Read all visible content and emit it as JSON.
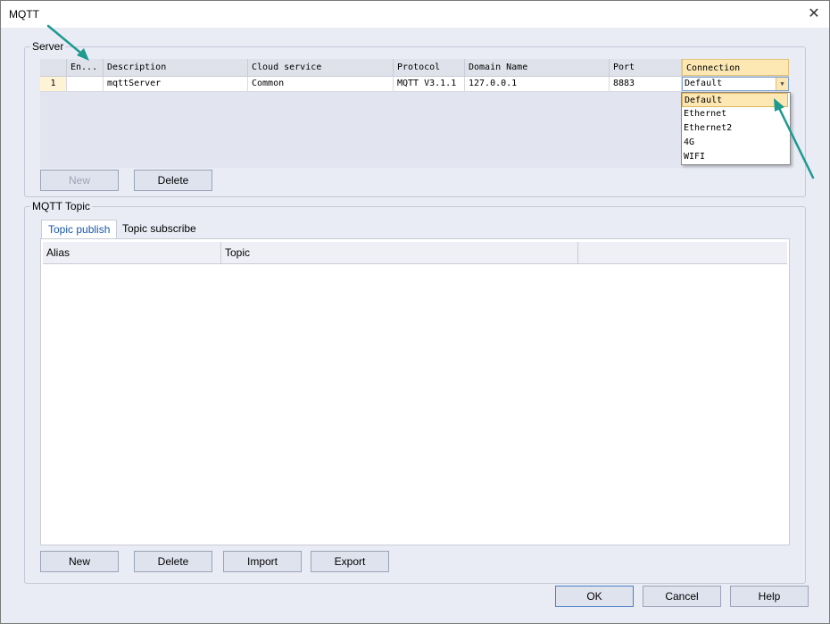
{
  "window": {
    "title": "MQTT",
    "close_glyph": "✕"
  },
  "server": {
    "legend": "Server",
    "columns": [
      "En...",
      "Description",
      "Cloud service",
      "Protocol",
      "Domain Name",
      "Port",
      "Connection"
    ],
    "row": {
      "number": "1",
      "enabled": true,
      "description": "mqttServer",
      "cloud_service": "Common",
      "protocol": "MQTT V3.1.1",
      "domain": "127.0.0.1",
      "port": "8883",
      "connection": "Default"
    },
    "dropdown_options": [
      "Default",
      "Ethernet",
      "Ethernet2",
      "4G",
      "WIFI"
    ],
    "new_label": "New",
    "delete_label": "Delete"
  },
  "topic": {
    "legend": "MQTT Topic",
    "tabs": [
      "Topic publish",
      "Topic subscribe"
    ],
    "columns": [
      "Alias",
      "Topic",
      ""
    ],
    "new_label": "New",
    "delete_label": "Delete",
    "import_label": "Import",
    "export_label": "Export"
  },
  "footer": {
    "ok_label": "OK",
    "cancel_label": "Cancel",
    "help_label": "Help"
  },
  "colors": {
    "annotation_arrow": "#1e9a8e",
    "accent_tab": "#1a57a8",
    "highlight": "#fde8b4"
  },
  "icons": {
    "close": "close-icon",
    "checkbox": "checkmark-icon",
    "combo": "chevron-down-icon"
  }
}
